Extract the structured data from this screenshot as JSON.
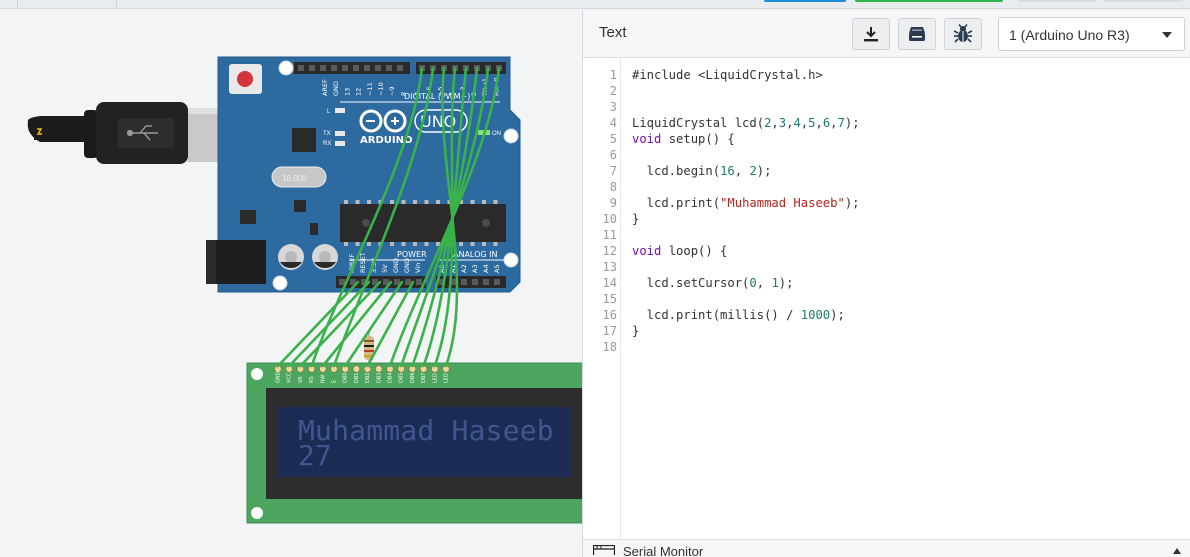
{
  "panel": {
    "title": "Text",
    "device_select": "1 (Arduino Uno R3)",
    "buttons": {
      "download": "download-icon",
      "libraries": "library-icon",
      "debugger": "bug-icon"
    }
  },
  "code": {
    "line_numbers": [
      "1",
      "2",
      "3",
      "4",
      "5",
      "6",
      "7",
      "8",
      "9",
      "10",
      "11",
      "12",
      "13",
      "14",
      "15",
      "16",
      "17",
      "18"
    ],
    "lines": [
      "#include <LiquidCrystal.h>",
      "",
      "",
      "LiquidCrystal lcd(2,3,4,5,6,7);",
      "void setup() {",
      "",
      "  lcd.begin(16, 2);",
      "",
      "  lcd.print(\"Muhammad Haseeb\");",
      "}",
      "",
      "void loop() {",
      "",
      "  lcd.setCursor(0, 1);",
      "",
      "  lcd.print(millis() / 1000);",
      "}",
      ""
    ]
  },
  "serial_monitor": {
    "label": "Serial Monitor"
  },
  "board": {
    "name": "ARDUINO",
    "model": "UNO",
    "digital_label": "DIGITAL (PWM~)",
    "power_label": "POWER",
    "analog_label": "ANALOG IN",
    "on_label": "ON",
    "tx_label": "TX",
    "rx_label": "RX",
    "l_label": "L",
    "crystal_label": "16.000",
    "top_pins": [
      "AREF",
      "GND",
      "13",
      "12",
      "~11",
      "~10",
      "~9",
      "8",
      "7",
      "~6",
      "~5",
      "4",
      "~3",
      "2",
      "TX→1",
      "RX←0"
    ],
    "power_pins": [
      "IOREF",
      "RESET",
      "3.3V",
      "5V",
      "GND",
      "GND",
      "Vin"
    ],
    "analog_pins": [
      "A0",
      "A1",
      "A2",
      "A3",
      "A4",
      "A5"
    ]
  },
  "lcd": {
    "line1": "Muhammad Haseeb",
    "line2": "27",
    "pins": [
      "GND",
      "VCC",
      "V0",
      "RS",
      "RW",
      "E",
      "DB0",
      "DB1",
      "DB2",
      "DB3",
      "DB4",
      "DB5",
      "DB6",
      "DB7",
      "LED",
      "LED"
    ]
  },
  "colors": {
    "board": "#2c6aa0",
    "wire": "#3ab24a",
    "lcd_pcb": "#4ca65f",
    "lcd_screen": "#1c2b54",
    "lcd_text": "#3f5690",
    "keyword": "#7a0fa3",
    "string": "#b3261e",
    "number": "#1e7a6b"
  }
}
